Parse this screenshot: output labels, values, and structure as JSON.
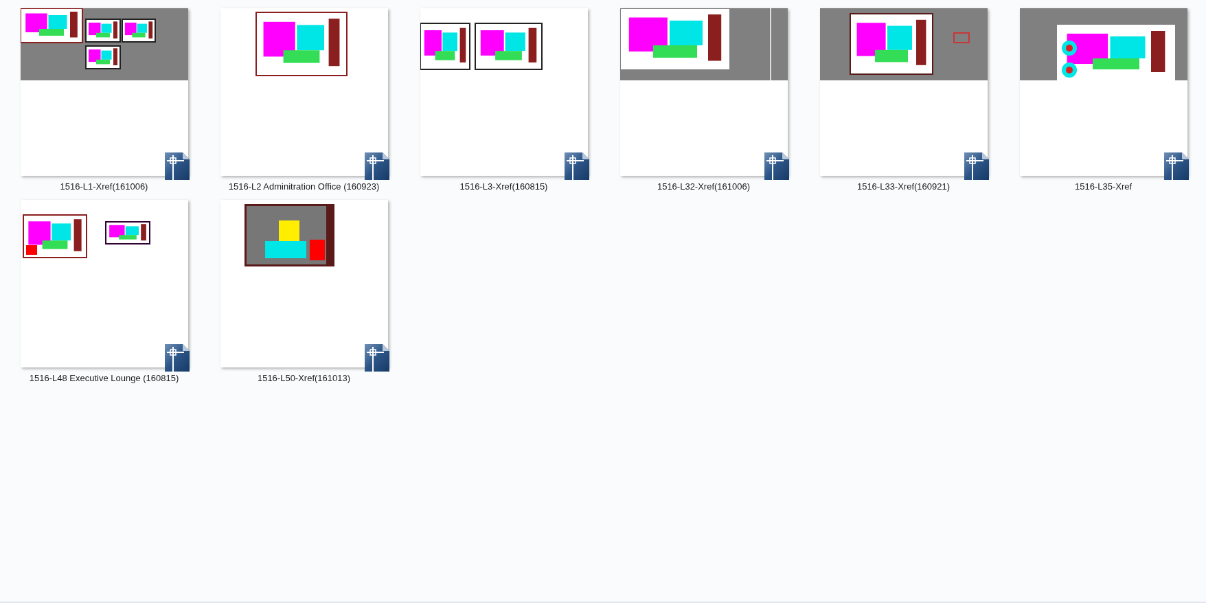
{
  "files": [
    {
      "name": "1516-L1-Xref(161006)"
    },
    {
      "name": "1516-L2 Adminitration Office (160923)"
    },
    {
      "name": "1516-L3-Xref(160815)"
    },
    {
      "name": "1516-L32-Xref(161006)"
    },
    {
      "name": "1516-L33-Xref(160921)"
    },
    {
      "name": "1516-L35-Xref"
    },
    {
      "name": "1516-L48 Executive Lounge (160815)"
    },
    {
      "name": "1516-L50-Xref(161013)"
    }
  ]
}
